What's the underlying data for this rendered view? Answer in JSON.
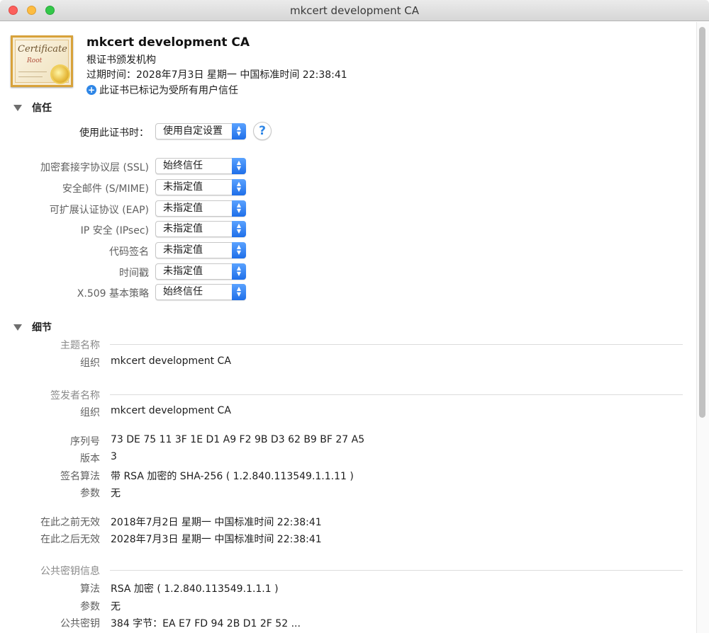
{
  "window": {
    "title": "mkcert development CA"
  },
  "header": {
    "cert_name": "mkcert development CA",
    "cert_kind": "根证书颁发机构",
    "expire": "过期时间：2028年7月3日 星期一 中国标准时间 22:38:41",
    "trust_note": "此证书已标记为受所有用户信任",
    "icon_word": "Certificate",
    "icon_word2": "Root"
  },
  "trust": {
    "section_title": "信任",
    "when_using_label": "使用此证书时：",
    "when_using_value": "使用自定设置",
    "help": "?",
    "rows": [
      {
        "label": "加密套接字协议层 (SSL)",
        "value": "始终信任"
      },
      {
        "label": "安全邮件 (S/MIME)",
        "value": "未指定值"
      },
      {
        "label": "可扩展认证协议 (EAP)",
        "value": "未指定值"
      },
      {
        "label": "IP 安全 (IPsec)",
        "value": "未指定值"
      },
      {
        "label": "代码签名",
        "value": "未指定值"
      },
      {
        "label": "时间戳",
        "value": "未指定值"
      },
      {
        "label": "X.509 基本策略",
        "value": "始终信任"
      }
    ]
  },
  "details": {
    "section_title": "细节",
    "subject": {
      "group": "主题名称",
      "key": "组织",
      "value": "mkcert development CA"
    },
    "issuer": {
      "group": "签发者名称",
      "key": "组织",
      "value": "mkcert development CA"
    },
    "serial": {
      "key": "序列号",
      "value": "73 DE 75 11 3F 1E D1 A9 F2 9B D3 62 B9 BF 27 A5"
    },
    "version": {
      "key": "版本",
      "value": "3"
    },
    "sig_alg": {
      "key": "签名算法",
      "value": "带 RSA 加密的 SHA-256 ( 1.2.840.113549.1.1.11 )"
    },
    "params": {
      "key": "参数",
      "value": "无"
    },
    "not_before": {
      "key": "在此之前无效",
      "value": "2018年7月2日 星期一 中国标准时间 22:38:41"
    },
    "not_after": {
      "key": "在此之后无效",
      "value": "2028年7月3日 星期一 中国标准时间 22:38:41"
    },
    "pubkey": {
      "group": "公共密钥信息",
      "alg_key": "算法",
      "alg_value": "RSA 加密 ( 1.2.840.113549.1.1.1 )",
      "params_key": "参数",
      "params_value": "无",
      "key_key": "公共密钥",
      "key_value": "384 字节：EA E7 FD 94 2B D1 2F 52 ..."
    }
  }
}
